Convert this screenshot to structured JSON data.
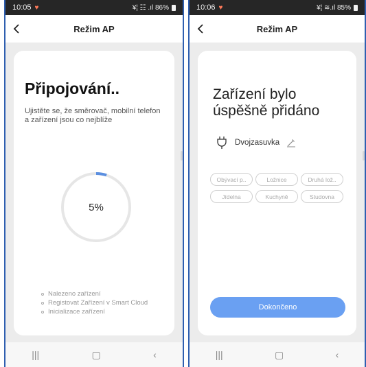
{
  "left": {
    "status": {
      "time": "10:05",
      "signal_text": "¥¦ ☷ .ıl 86%"
    },
    "nav": {
      "title": "Režim AP"
    },
    "card": {
      "title": "Připojování..",
      "description": "Ujistěte se, že směrovač, mobilní telefon a zařízení jsou co nejblíže",
      "progress_percent": 5,
      "progress_label": "5%",
      "steps": [
        "Nalezeno zařízení",
        "Registovat Zařízení v Smart Cloud",
        "Inicializace zařízení"
      ]
    }
  },
  "right": {
    "status": {
      "time": "10:06",
      "signal_text": "¥¦ ≋.ıl 85%"
    },
    "nav": {
      "title": "Režim AP"
    },
    "card": {
      "title": "Zařízení bylo úspěšně přidáno",
      "device_name": "Dvojzasuvka",
      "rooms": [
        "Obývací p..",
        "Ložnice",
        "Druhá lož..",
        "Jídelna",
        "Kuchyně",
        "Studovna"
      ],
      "done_label": "Dokončeno"
    }
  },
  "colors": {
    "accent": "#6aa0f2",
    "progress_arc": "#5b8fe0",
    "status_heart": "#ff7a5a",
    "frame": "#2f5fb0"
  },
  "icons": {
    "back": "chevron-left-icon",
    "device": "plug-icon",
    "edit": "pencil-icon",
    "recent": "recent-apps-icon",
    "home": "home-icon",
    "nav_back": "back-icon"
  }
}
